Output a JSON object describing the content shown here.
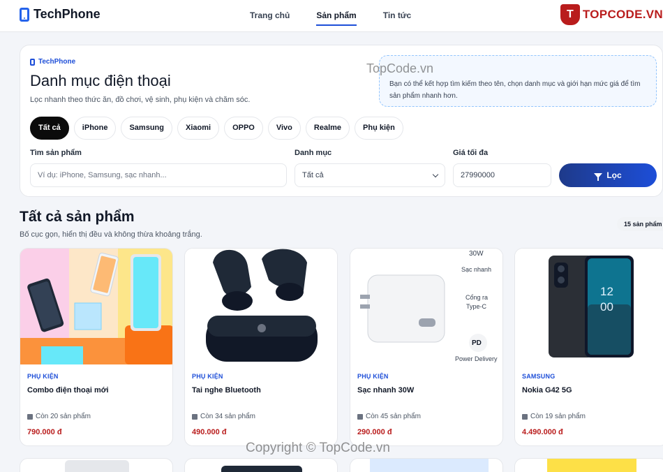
{
  "header": {
    "brand": "TechPhone",
    "nav": [
      "Trang chủ",
      "Sản phẩm",
      "Tin tức"
    ],
    "active_nav": "Sản phẩm"
  },
  "watermark": {
    "logo_text": "TOPCODE.VN",
    "logo_letter": "T",
    "top_text": "TopCode.vn",
    "copyright": "Copyright © TopCode.vn"
  },
  "hero": {
    "brand_label": "TechPhone",
    "title": "Danh mục điện thoại",
    "subtitle": "Lọc nhanh theo thức ăn, đồ chơi, vệ sinh, phụ kiện và chăm sóc.",
    "tip": "Bạn có thể kết hợp tìm kiếm theo tên, chọn danh mục và giới hạn mức giá để tìm sản phẩm nhanh hơn.",
    "chips": [
      "Tất cả",
      "iPhone",
      "Samsung",
      "Xiaomi",
      "OPPO",
      "Vivo",
      "Realme",
      "Phụ kiện"
    ],
    "active_chip": "Tất cả"
  },
  "filters": {
    "search_label": "Tìm sản phẩm",
    "search_placeholder": "Ví dụ: iPhone, Samsung, sạc nhanh...",
    "category_label": "Danh mục",
    "category_value": "Tất cả",
    "price_label": "Giá tối đa",
    "price_value": "27990000",
    "filter_button": "Lọc"
  },
  "section": {
    "title": "Tất cả sản phẩm",
    "subtitle": "Bố cục gọn, hiển thị đều và không thừa khoảng trắng.",
    "count": "15 sản phẩm"
  },
  "products": [
    {
      "category": "PHỤ KIỆN",
      "name": "Combo điện thoại mới",
      "stock": "Còn 20 sản phẩm",
      "price": "790.000 đ",
      "image": "phone-combo"
    },
    {
      "category": "PHỤ KIỆN",
      "name": "Tai nghe Bluetooth",
      "stock": "Còn 34 sản phẩm",
      "price": "490.000 đ",
      "image": "earbuds"
    },
    {
      "category": "PHỤ KIỆN",
      "name": "Sạc nhanh 30W",
      "stock": "Còn 45 sản phẩm",
      "price": "290.000 đ",
      "image": "charger",
      "image_text": {
        "watt": "30W",
        "fast": "Sạc nhanh",
        "port": "Cổng ra",
        "port_type": "Type-C",
        "pd": "PD",
        "pd_label": "Power Delivery"
      }
    },
    {
      "category": "SAMSUNG",
      "name": "Nokia G42 5G",
      "stock": "Còn 19 sản phẩm",
      "price": "4.490.000 đ",
      "image": "nokia-phone",
      "image_text": {
        "clock_h": "12",
        "clock_m": "00"
      }
    }
  ],
  "colors": {
    "accent": "#1d4ed8",
    "price": "#b91c1c",
    "chip_active": "#0b0b0b"
  }
}
